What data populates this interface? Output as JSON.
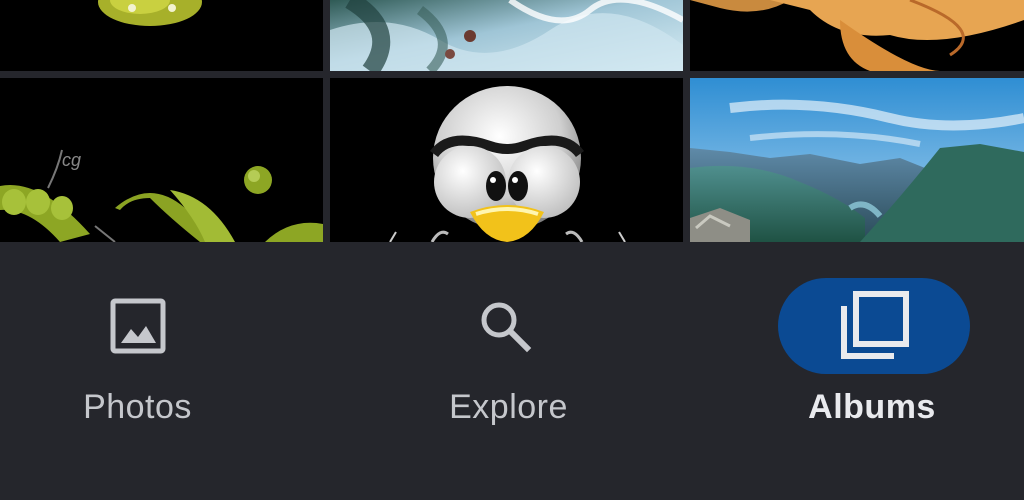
{
  "photo_grid": {
    "thumbnails": [
      {
        "name": "green-pea-crop"
      },
      {
        "name": "water-splash"
      },
      {
        "name": "orange-flower-crop"
      },
      {
        "name": "pea-pods"
      },
      {
        "name": "penguin-mascot"
      },
      {
        "name": "mountain-fjord"
      }
    ]
  },
  "bottom_nav": {
    "items": [
      {
        "label": "Photos",
        "icon": "image-icon",
        "selected": false
      },
      {
        "label": "Explore",
        "icon": "search-icon",
        "selected": false
      },
      {
        "label": "Albums",
        "icon": "albums-icon",
        "selected": true
      }
    ]
  },
  "colors": {
    "background": "#25262c",
    "selected_pill": "#0b4a93",
    "label_inactive": "#c5c7cc",
    "label_active": "#e9eaee"
  }
}
